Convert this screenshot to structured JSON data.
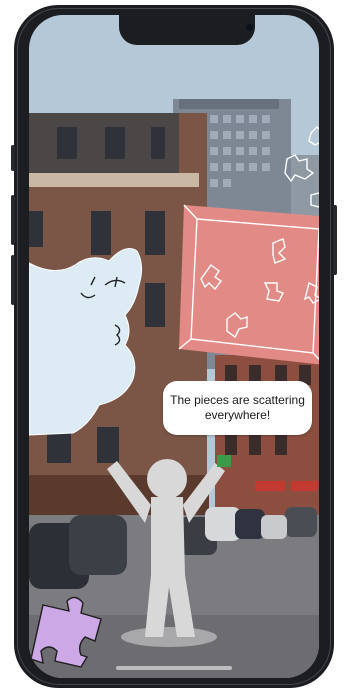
{
  "speech_bubble": {
    "text": "The pieces are scattering everywhere!"
  },
  "colors": {
    "phone_frame": "#1b1d21",
    "sky": "#b4c8d8",
    "puzzle_box": "#e28a85",
    "ghost": "#dcebf4",
    "stick_figure": "#d8d8d8",
    "puzzle_piece_purple": "#cda8e6"
  },
  "icons": [
    "puzzle-piece-icon"
  ]
}
